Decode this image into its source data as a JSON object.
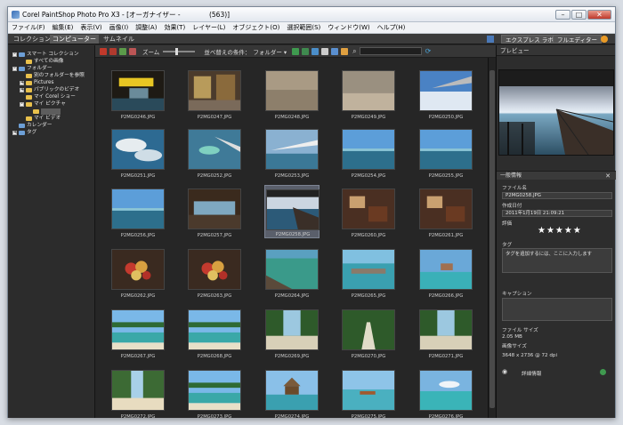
{
  "titlebar": {
    "title": "Corel PaintShop Photo Pro X3 - [オーガナイザー - ",
    "suffix": "(563)]"
  },
  "menu": [
    "ファイル(F)",
    "編集(E)",
    "表示(V)",
    "画像(I)",
    "調整(A)",
    "効果(T)",
    "レイヤー(L)",
    "オブジェクト(O)",
    "選択範囲(S)",
    "ウィンドウ(W)",
    "ヘルプ(H)"
  ],
  "tabs": {
    "collection": "コレクション",
    "computer": "コンピューター",
    "thumbnails": "サムネイル",
    "express_lab": "エクスプレス ラボ",
    "full_editor": "フルエディター",
    "preview": "プレビュー"
  },
  "tree": [
    {
      "label": "スマート コレクション",
      "indent": 0,
      "exp": "-",
      "folder": "blue"
    },
    {
      "label": "すべての画像",
      "indent": 1,
      "exp": "",
      "folder": "yellow"
    },
    {
      "label": "フォルダー",
      "indent": 0,
      "exp": "-",
      "folder": "blue"
    },
    {
      "label": "別のフォルダーを参照",
      "indent": 1,
      "exp": "",
      "folder": "yellow"
    },
    {
      "label": "Pictures",
      "indent": 1,
      "exp": "+",
      "folder": "yellow"
    },
    {
      "label": "パブリックのビデオ",
      "indent": 1,
      "exp": "+",
      "folder": "yellow"
    },
    {
      "label": "マイ Corel ショー",
      "indent": 1,
      "exp": "",
      "folder": "yellow"
    },
    {
      "label": "マイ ピクチャ",
      "indent": 1,
      "exp": "-",
      "folder": "yellow"
    },
    {
      "label": "",
      "indent": 2,
      "exp": "",
      "folder": "yellow",
      "selected": true
    },
    {
      "label": "マイ ビデオ",
      "indent": 1,
      "exp": "",
      "folder": "yellow"
    },
    {
      "label": "カレンダー",
      "indent": 0,
      "exp": "",
      "folder": "blue"
    },
    {
      "label": "タグ",
      "indent": 0,
      "exp": "+",
      "folder": "blue"
    }
  ],
  "toolbar": {
    "zoom_label": "ズーム",
    "sort_label": "並べ替えの条件：",
    "sort_value": "フォルダー",
    "search_placeholder": ""
  },
  "thumbnails": [
    {
      "file": "P2MG0246.JPG",
      "scene": "sign"
    },
    {
      "file": "P2MG0247.JPG",
      "scene": "shop"
    },
    {
      "file": "P2MG0248.JPG",
      "scene": "haze"
    },
    {
      "file": "P2MG0249.JPG",
      "scene": "haze2"
    },
    {
      "file": "P2MG0250.JPG",
      "scene": "wing"
    },
    {
      "file": "P2MG0251.JPG",
      "scene": "clouds"
    },
    {
      "file": "P2MG0252.JPG",
      "scene": "island_wing"
    },
    {
      "file": "P2MG0253.JPG",
      "scene": "wing2"
    },
    {
      "file": "P2MG0254.JPG",
      "scene": "sea"
    },
    {
      "file": "P2MG0255.JPG",
      "scene": "sea"
    },
    {
      "file": "P2MG0256.JPG",
      "scene": "sea"
    },
    {
      "file": "P2MG0257.JPG",
      "scene": "deck"
    },
    {
      "file": "P2MG0258.JPG",
      "scene": "pier",
      "selected": true
    },
    {
      "file": "P2MG0260.JPG",
      "scene": "room"
    },
    {
      "file": "P2MG0261.JPG",
      "scene": "room"
    },
    {
      "file": "P2MG0262.JPG",
      "scene": "fruit"
    },
    {
      "file": "P2MG0263.JPG",
      "scene": "fruit"
    },
    {
      "file": "P2MG0264.JPG",
      "scene": "lagoon"
    },
    {
      "file": "P2MG0265.JPG",
      "scene": "pool"
    },
    {
      "file": "P2MG0266.JPG",
      "scene": "villa"
    },
    {
      "file": "P2MG0267.JPG",
      "scene": "beach"
    },
    {
      "file": "P2MG0268.JPG",
      "scene": "beach"
    },
    {
      "file": "P2MG0269.JPG",
      "scene": "palms"
    },
    {
      "file": "P2MG0270.JPG",
      "scene": "path"
    },
    {
      "file": "P2MG0271.JPG",
      "scene": "palms"
    },
    {
      "file": "P2MG0272.JPG",
      "scene": "beach2"
    },
    {
      "file": "P2MG0273.JPG",
      "scene": "beach"
    },
    {
      "file": "P2MG0274.JPG",
      "scene": "hut"
    },
    {
      "file": "P2MG0275.JPG",
      "scene": "boat"
    },
    {
      "file": "P2MG0276.JPG",
      "scene": "lagoon2"
    }
  ],
  "info": {
    "section_title": "一般情報",
    "filename_label": "ファイル名",
    "filename": "P2MG0258.JPG",
    "date_label": "作成日付",
    "date": "2011年1月19日 21:09:21",
    "rating_label": "評価",
    "stars": "★★★★★",
    "tags_label": "タグ",
    "tags_placeholder": "タグを追加するには、ここに入力します",
    "caption_label": "キャプション",
    "filesize_label": "ファイル サイズ",
    "filesize": "2.05 MB",
    "imagesize_label": "画像サイズ",
    "imagesize": "3648 x 2736 @ 72 dpi",
    "details_label": "詳細情報"
  }
}
